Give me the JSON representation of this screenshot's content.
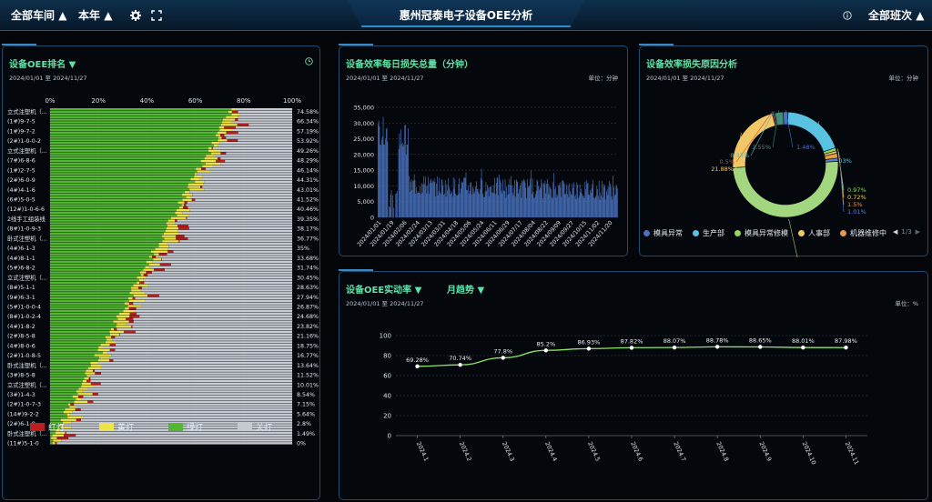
{
  "header": {
    "workshop": "全部车间",
    "workshop_arrow": "▲",
    "period": "本年",
    "period_arrow": "▲",
    "title": "惠州冠泰电子设备OEE分析",
    "shift": "全部班次",
    "shift_arrow": "▲"
  },
  "colors": {
    "red": "#b9201f",
    "yellow": "#ede44a",
    "green": "#53b733",
    "grey": "#c5c9d0",
    "accent": "#5fe3a8",
    "bar": "#4a74c2",
    "line": "#8fe26b"
  },
  "ranking": {
    "title": "设备OEE排名",
    "title_arrow": "▼",
    "date": "2024/01/01 至 2024/11/27",
    "x_ticks": [
      "0%",
      "20%",
      "40%",
      "60%",
      "80%",
      "100%"
    ],
    "legend": [
      {
        "name": "红灯",
        "color": "#b9201f"
      },
      {
        "name": "黄灯",
        "color": "#ede44a"
      },
      {
        "name": "绿灯",
        "color": "#53b733"
      },
      {
        "name": "关灯",
        "color": "#c5c9d0"
      }
    ],
    "labels": [
      "立式注塑机（...",
      "(1#)9-7-5",
      "(1#)9-7-2",
      "(2#)1-0-0-2",
      "立式注塑机（...",
      "(7#)6-8-6",
      "(1#)2-7-5",
      "(2#)6-0-9",
      "(4#)4-1-6",
      "(6#)5-0-5",
      "(12#)1-0-6-6",
      "2线手工组装线",
      "(8#)1-0-9-3",
      "卧式注塑机（...",
      "(4#)6-1-3",
      "(4#)8-1-1",
      "(5#)6-8-2",
      "立式注塑机（...",
      "(8#)5-1-1",
      "(9#)6-3-1",
      "(5#)1-0-0-4",
      "(8#)1-0-2-4",
      "(4#)1-8-2",
      "(2#)8-5-8",
      "(4#)8-0-6",
      "(2#)1-0-8-5",
      "卧式注塑机（...",
      "(3#)8-5-8",
      "立式注塑机（...",
      "(3#)1-4-3",
      "(2#)1-0-7-3",
      "(14#)9-2-2",
      "(2#)6-1-8",
      "卧式注塑机（...",
      "(11#)5-1-0"
    ],
    "values": [
      "74.58%",
      "66.34%",
      "57.19%",
      "53.92%",
      "49.26%",
      "48.29%",
      "46.14%",
      "44.31%",
      "43.01%",
      "41.52%",
      "40.46%",
      "39.35%",
      "38.17%",
      "36.77%",
      "35%",
      "33.68%",
      "31.74%",
      "30.45%",
      "28.63%",
      "27.94%",
      "26.87%",
      "24.68%",
      "23.82%",
      "21.16%",
      "18.75%",
      "16.77%",
      "13.64%",
      "11.52%",
      "10.01%",
      "8.54%",
      "7.15%",
      "5.64%",
      "2.8%",
      "1.49%",
      "0%"
    ]
  },
  "daily_loss": {
    "title": "设备效率每日损失总量（分钟）",
    "date": "2024/01/01 至 2024/11/27",
    "unit": "单位：分钟",
    "y_ticks": [
      "35,000",
      "30,000",
      "25,000",
      "20,000",
      "15,000",
      "10,000",
      "5,000",
      "0"
    ],
    "chart_data": {
      "type": "bar",
      "ylim": [
        0,
        35000
      ],
      "x_ticks": [
        "2024/01/01",
        "2024/01/19",
        "2024/02/06",
        "2024/02/24",
        "2024/03/13",
        "2024/03/31",
        "2024/04/18",
        "2024/05/06",
        "2024/05/24",
        "2024/06/11",
        "2024/06/29",
        "2024/07/17",
        "2024/08/04",
        "2024/08/22",
        "2024/09/09",
        "2024/09/27",
        "2024/10/15",
        "2024/11/02",
        "2024/11/20"
      ]
    }
  },
  "loss_reason": {
    "title": "设备效率损失原因分析",
    "date": "2024/01/01 至 2024/11/27",
    "unit": "单位：分钟",
    "chart_data": {
      "type": "pie",
      "slices": [
        {
          "label": "19.03%",
          "value": 19.03,
          "color": "#58c2e0"
        },
        {
          "label": "0.97%",
          "value": 0.97,
          "color": "#8fd75f"
        },
        {
          "label": "0.72%",
          "value": 0.72,
          "color": "#f2c95a"
        },
        {
          "label": "1.5%",
          "value": 1.5,
          "color": "#e39b44"
        },
        {
          "label": "1.01%",
          "value": 1.01,
          "color": "#5b7fd0"
        },
        {
          "label": "50.03%",
          "value": 50.03,
          "color": "#a2d67f"
        },
        {
          "label": "21.88%",
          "value": 21.88,
          "color": "#f2c866"
        },
        {
          "label": "0.5%",
          "value": 0.5,
          "color": "#c74a3b"
        },
        {
          "label": "0.33%",
          "value": 0.33,
          "color": "#54b9c2"
        },
        {
          "label": "2.55%",
          "value": 2.55,
          "color": "#3f8f7a"
        },
        {
          "label": "1.48%",
          "value": 1.48,
          "color": "#4a6fc4"
        }
      ]
    },
    "legend": [
      {
        "name": "模具异常",
        "color": "#4a6fc4"
      },
      {
        "name": "生产部",
        "color": "#58c2e0"
      },
      {
        "name": "模具异常修模",
        "color": "#8fd75f"
      },
      {
        "name": "人事部",
        "color": "#f2c95a"
      },
      {
        "name": "机器维修中",
        "color": "#e39b44"
      }
    ],
    "pager": "1/3",
    "pager_prev": "◀",
    "pager_next": "▶"
  },
  "oee_rate": {
    "title": "设备OEE实动率",
    "title_arrow": "▼",
    "mode": "月趋势",
    "mode_arrow": "▼",
    "date": "2024/01/01 至 2024/11/27",
    "unit": "单位：%",
    "chart_data": {
      "type": "line",
      "ylim": [
        0,
        100
      ],
      "y_ticks": [
        "100",
        "80",
        "60",
        "40",
        "20",
        "0"
      ],
      "x": [
        "2024.1",
        "2024.2",
        "2024.3",
        "2024.4",
        "2024.5",
        "2024.6",
        "2024.7",
        "2024.8",
        "2024.9",
        "2024.10",
        "2024.11"
      ],
      "values": [
        69.28,
        70.74,
        77.8,
        85.2,
        86.93,
        87.82,
        88.07,
        88.78,
        88.65,
        88.01,
        87.98
      ],
      "labels": [
        "69.28%",
        "70.74%",
        "77.8%",
        "85.2%",
        "86.93%",
        "87.82%",
        "88.07%",
        "88.78%",
        "88.65%",
        "88.01%",
        "87.98%"
      ]
    }
  }
}
